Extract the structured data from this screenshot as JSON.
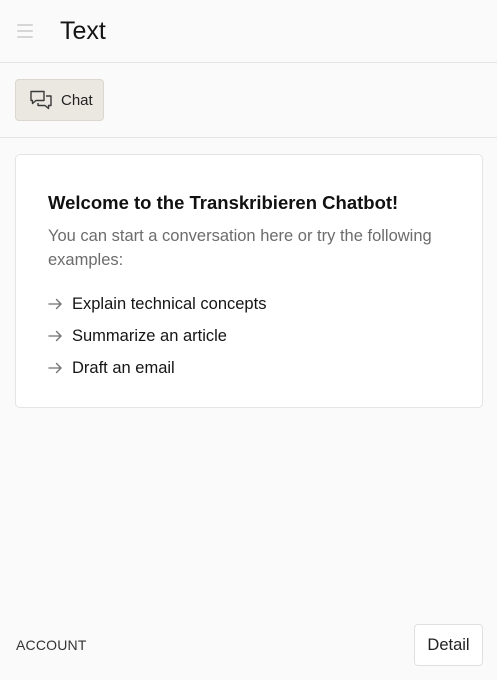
{
  "header": {
    "menu_icon": "hamburger-menu-icon",
    "title": "Text"
  },
  "toolbar": {
    "chat_tab": {
      "label": "Chat",
      "icon": "chat-bubbles-icon",
      "active": true
    }
  },
  "welcome_card": {
    "heading": "Welcome to the Transkribieren Chatbot!",
    "intro": "You can start a conversation here or try the following examples:",
    "examples": [
      {
        "label": "Explain technical concepts",
        "icon": "arrow-right-icon"
      },
      {
        "label": "Summarize an article",
        "icon": "arrow-right-icon"
      },
      {
        "label": "Draft an email",
        "icon": "arrow-right-icon"
      }
    ]
  },
  "footer": {
    "account_label": "ACCOUNT",
    "detail_button": "Detail"
  },
  "colors": {
    "background": "#fafafa",
    "active_tab": "#ebe8e2",
    "card": "#ffffff",
    "border": "#e4e4e4",
    "muted_text": "#6c6c6c"
  }
}
